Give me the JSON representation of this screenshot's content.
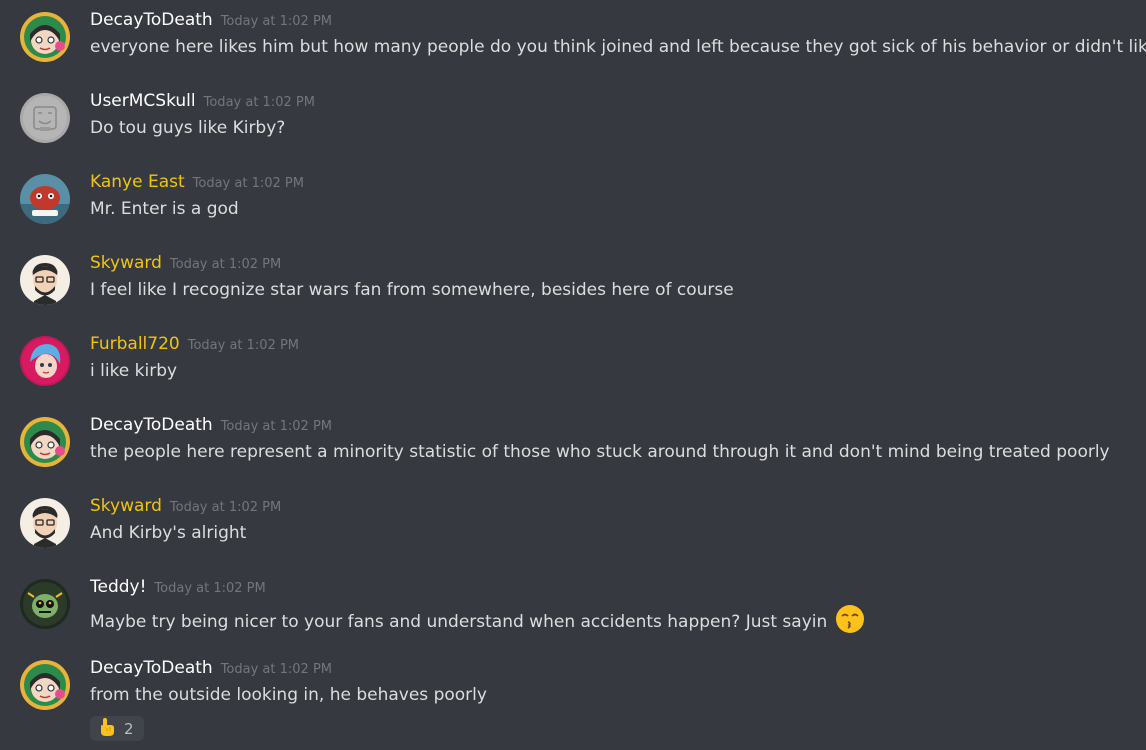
{
  "colors": {
    "background": "#36393f",
    "username_default": "#ffffff",
    "username_gold": "#f1c40f",
    "timestamp": "#72767d",
    "message_text": "#dcddde",
    "reaction_bg": "#40444b"
  },
  "messages": [
    {
      "username": "DecayToDeath",
      "timestamp": "Today at 1:02 PM",
      "text": "everyone here likes him but how many people do you think joined and left because they got sick of his behavior or didn't like it"
    },
    {
      "username": "UserMCSkull",
      "timestamp": "Today at 1:02 PM",
      "text": "Do tou guys like Kirby?"
    },
    {
      "username": "Kanye East",
      "timestamp": "Today at 1:02 PM",
      "text": "Mr. Enter is a god"
    },
    {
      "username": "Skyward",
      "timestamp": "Today at 1:02 PM",
      "text": "I feel like I recognize star wars fan from somewhere, besides here of course"
    },
    {
      "username": "Furball720",
      "timestamp": "Today at 1:02 PM",
      "text": "i like kirby"
    },
    {
      "username": "DecayToDeath",
      "timestamp": "Today at 1:02 PM",
      "text": "the people here represent a minority statistic of those who stuck around through it and don't mind being treated poorly"
    },
    {
      "username": "Skyward",
      "timestamp": "Today at 1:02 PM",
      "text": "And Kirby's alright"
    },
    {
      "username": "Teddy!",
      "timestamp": "Today at 1:02 PM",
      "text": "Maybe try being nicer to your fans and understand when accidents happen? Just sayin",
      "emoji": "kissing-face-emoji"
    },
    {
      "username": "DecayToDeath",
      "timestamp": "Today at 1:02 PM",
      "text": "from the outside looking in, he behaves poorly"
    }
  ],
  "reaction": {
    "icon": "pointing-up-hand-emoji",
    "count": "2"
  }
}
